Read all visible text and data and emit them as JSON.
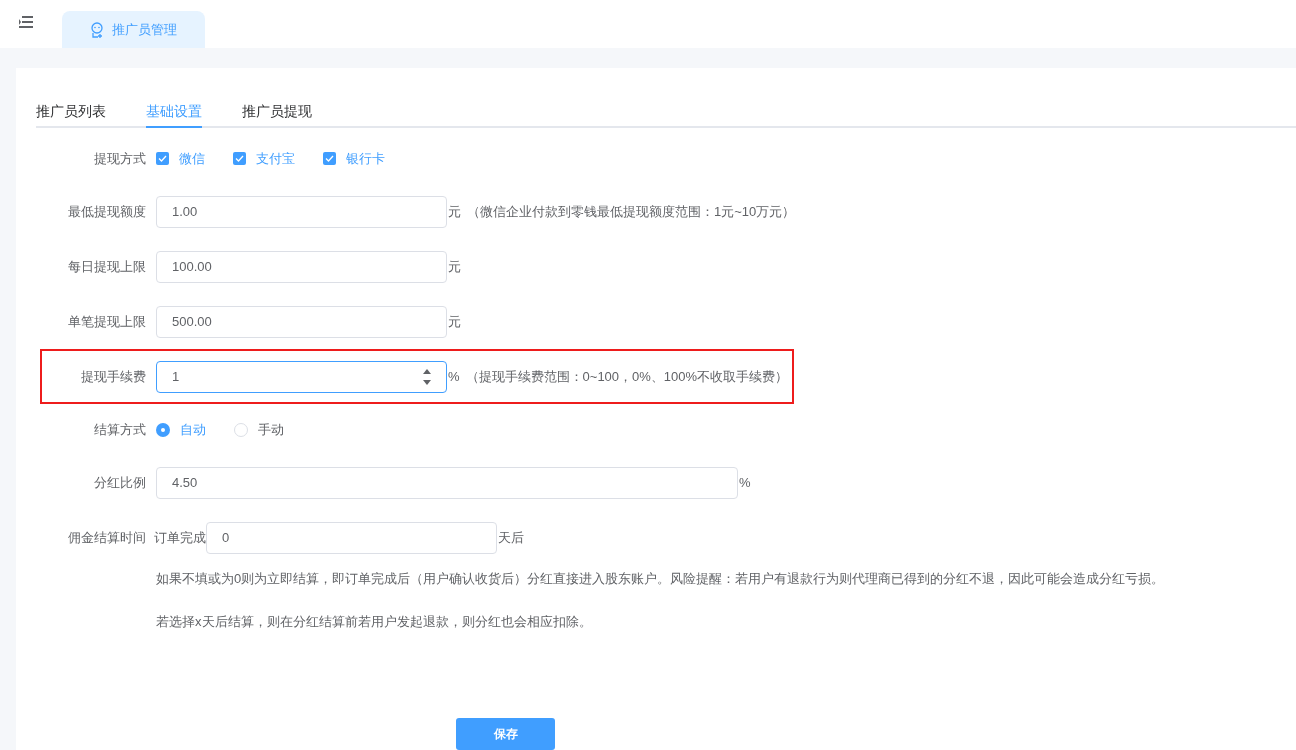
{
  "page_tab": {
    "label": "推广员管理",
    "selected": true
  },
  "tabs": [
    {
      "label": "推广员列表",
      "selected": false
    },
    {
      "label": "基础设置",
      "selected": true
    },
    {
      "label": "推广员提现",
      "selected": false
    }
  ],
  "form": [
    {
      "kind": "checkboxes",
      "label": "提现方式",
      "options": [
        {
          "label": "微信",
          "checked": true
        },
        {
          "label": "支付宝",
          "checked": true
        },
        {
          "label": "银行卡",
          "checked": true
        }
      ]
    },
    {
      "kind": "input",
      "label": "最低提现额度",
      "value": "1.00",
      "unit": "元",
      "note": "（微信企业付款到零钱最低提现额度范围：1元~10万元）",
      "highlighted": false,
      "spinner": false,
      "wide": false
    },
    {
      "kind": "input",
      "label": "每日提现上限",
      "value": "100.00",
      "unit": "元",
      "highlighted": false,
      "spinner": false,
      "wide": false
    },
    {
      "kind": "input",
      "label": "单笔提现上限",
      "value": "500.00",
      "unit": "元",
      "highlighted": false,
      "spinner": false,
      "wide": false
    },
    {
      "kind": "input",
      "label": "提现手续费",
      "value": "1",
      "unit": "%",
      "note": "（提现手续费范围：0~100，0%、100%不收取手续费）",
      "highlighted": true,
      "spinner": true,
      "wide": false
    },
    {
      "kind": "radios",
      "label": "结算方式",
      "options": [
        {
          "label": "自动",
          "selected": true
        },
        {
          "label": "手动",
          "selected": false
        }
      ]
    },
    {
      "kind": "input",
      "label": "分红比例",
      "value": "4.50",
      "unit": "%",
      "highlighted": false,
      "spinner": false,
      "wide": true
    },
    {
      "kind": "input",
      "label": "佣金结算时间",
      "prefix": "订单完成",
      "value": "0",
      "unit": "天后",
      "highlighted": false,
      "spinner": false,
      "wide": false
    }
  ],
  "notes": [
    "如果不填或为0则为立即结算，即订单完成后（用户确认收货后）分红直接进入股东账户。风险提醒：若用户有退款行为则代理商已得到的分红不退，因此可能会造成分红亏损。",
    "若选择x天后结算，则在分红结算前若用户发起退款，则分红也会相应扣除。"
  ],
  "save_button": "保存"
}
